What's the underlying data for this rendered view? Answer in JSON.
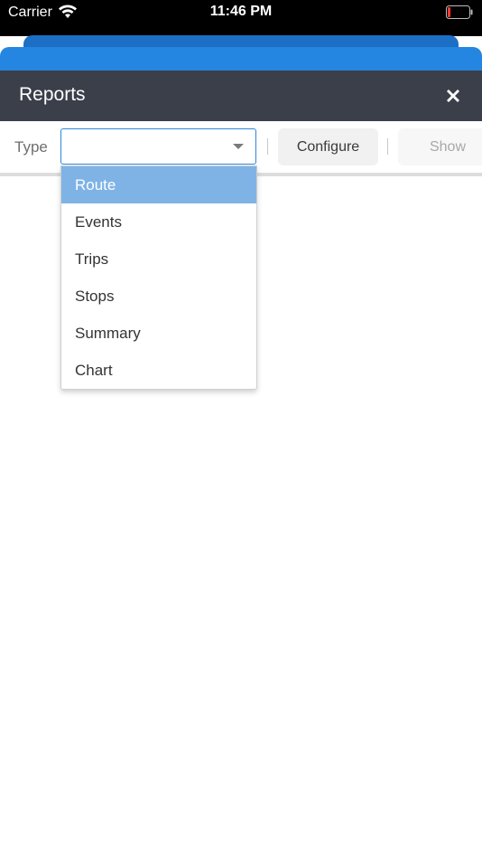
{
  "status_bar": {
    "carrier": "Carrier",
    "time": "11:46 PM"
  },
  "header": {
    "title": "Reports"
  },
  "toolbar": {
    "type_label": "Type",
    "type_value": "",
    "configure_label": "Configure",
    "show_label": "Show"
  },
  "dropdown": {
    "options": [
      "Route",
      "Events",
      "Trips",
      "Stops",
      "Summary",
      "Chart"
    ],
    "highlighted": "Route"
  },
  "colors": {
    "header_bg": "#3b3f4a",
    "accent_blue": "#2486e0",
    "highlight": "#7fb3e6"
  }
}
